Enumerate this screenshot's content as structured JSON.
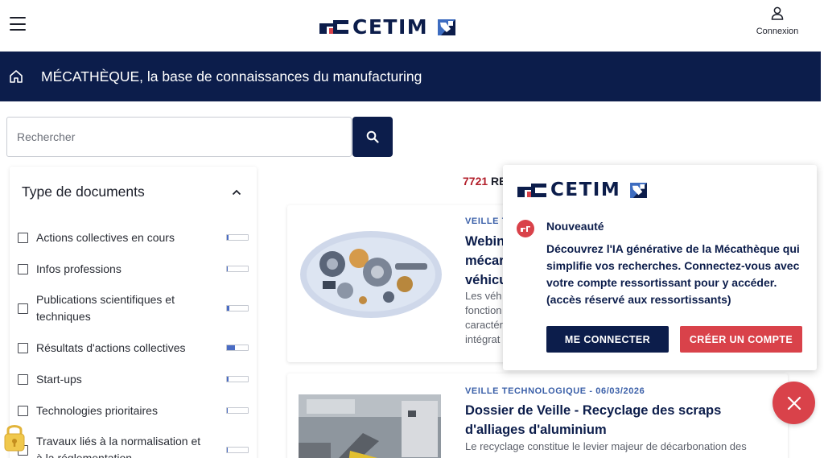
{
  "header": {
    "logo_text": "CETIM",
    "login_label": "Connexion",
    "icons": {
      "menu": "hamburger-icon",
      "user": "user-icon"
    }
  },
  "banner": {
    "title": "MÉCATHÈQUE, la base de connaissances du manufacturing",
    "icon": "home-icon"
  },
  "search": {
    "placeholder": "Rechercher",
    "value": "",
    "icon": "search-icon"
  },
  "filters": {
    "title": "Type de documents",
    "items": [
      {
        "label": "Actions collectives en cours",
        "checked": false,
        "share": 0.06
      },
      {
        "label": "Infos professions",
        "checked": false,
        "share": 0.04
      },
      {
        "label": "Publications scientifiques et techniques",
        "checked": false,
        "share": 0.1
      },
      {
        "label": "Résultats d'actions collectives",
        "checked": false,
        "share": 0.38
      },
      {
        "label": "Start-ups",
        "checked": false,
        "share": 0.06
      },
      {
        "label": "Technologies prioritaires",
        "checked": false,
        "share": 0.04
      },
      {
        "label": "Travaux liés à la normalisation et à la réglementation",
        "checked": false,
        "share": 0.05
      }
    ]
  },
  "results": {
    "count": "7721",
    "count_suffix": "RE",
    "cards": [
      {
        "category": "VEILLE T",
        "title": "Webin\nmécar\nvéhicu",
        "description": "Les véh\nfonction\ncaractér\nintégrat"
      },
      {
        "category": "VEILLE TECHNOLOGIQUE - 06/03/2026",
        "title": "Dossier de Veille - Recyclage des scraps d'alliages d'aluminium",
        "description": "Le recyclage constitue le levier majeur de décarbonation des"
      }
    ]
  },
  "popup": {
    "logo_text": "CETIM",
    "title": "Nouveauté",
    "text": "Découvrez l'IA générative de la Mécathèque qui simplifie vos recherches. Connectez-vous avec votre compte ressortissant pour y accéder. (accès réservé aux ressortissants)",
    "login_button": "ME CONNECTER",
    "create_button": "CRÉER UN COMPTE",
    "icon": "cetim-badge-icon"
  },
  "colors": {
    "navy": "#0c1d4b",
    "accent_red": "#d9424a",
    "count_red": "#b3202c",
    "category_blue": "#3a5fa8",
    "bar_fill": "#4a6cc4"
  }
}
